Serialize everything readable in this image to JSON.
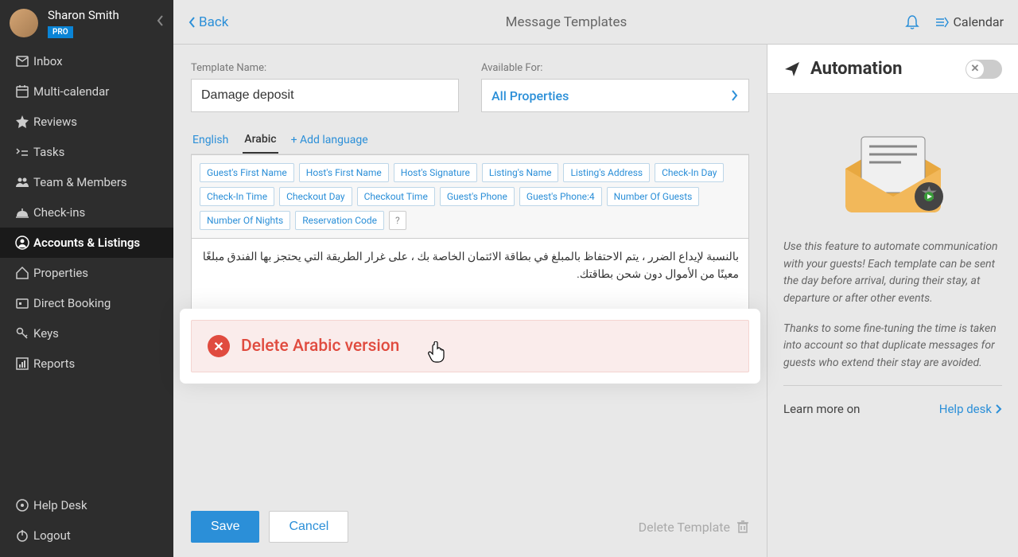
{
  "profile": {
    "name": "Sharon Smith",
    "badge": "PRO"
  },
  "nav": {
    "items": [
      {
        "label": "Inbox"
      },
      {
        "label": "Multi-calendar"
      },
      {
        "label": "Reviews"
      },
      {
        "label": "Tasks"
      },
      {
        "label": "Team & Members"
      },
      {
        "label": "Check-ins"
      },
      {
        "label": "Accounts & Listings"
      },
      {
        "label": "Properties"
      },
      {
        "label": "Direct Booking"
      },
      {
        "label": "Keys"
      },
      {
        "label": "Reports"
      }
    ],
    "bottom": [
      {
        "label": "Help Desk"
      },
      {
        "label": "Logout"
      }
    ]
  },
  "header": {
    "back": "Back",
    "title": "Message Templates",
    "calendar": "Calendar"
  },
  "form": {
    "template_name_label": "Template Name:",
    "template_name_value": "Damage deposit",
    "available_for_label": "Available For:",
    "available_for_value": "All Properties"
  },
  "lang_tabs": {
    "english": "English",
    "arabic": "Arabic",
    "add": "+ Add language"
  },
  "tags": [
    "Guest's First Name",
    "Host's First Name",
    "Host's Signature",
    "Listing's Name",
    "Listing's Address",
    "Check-In Day",
    "Check-In Time",
    "Checkout Day",
    "Checkout Time",
    "Guest's Phone",
    "Guest's Phone:4",
    "Number Of Guests",
    "Number Of Nights",
    "Reservation Code"
  ],
  "tag_help": "?",
  "message_body": "بالنسبة لإيداع الضرر ، يتم الاحتفاظ بالمبلغ في بطاقة الائتمان الخاصة بك ، على غرار الطريقة التي يحتجز بها الفندق مبلغًا معينًا من الأموال دون شحن بطاقتك.",
  "delete_lang": "Delete Arabic version",
  "actions": {
    "save": "Save",
    "cancel": "Cancel",
    "delete_template": "Delete Template"
  },
  "automation": {
    "title": "Automation",
    "p1": "Use this feature to automate communication with your guests! Each template can be sent the day before arrival, during their stay, at departure or after other events.",
    "p2": "Thanks to some fine-tuning the time is taken into account so that duplicate messages for guests who extend their stay are avoided.",
    "learn": "Learn more on",
    "help_desk": "Help desk"
  }
}
